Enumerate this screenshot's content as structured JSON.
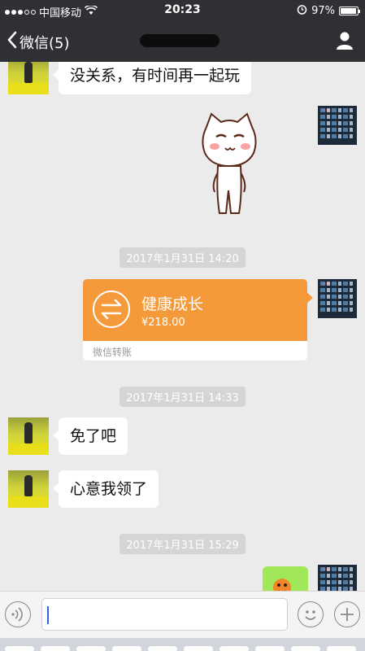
{
  "status_bar": {
    "carrier": "中国移动",
    "time": "20:23",
    "battery": "97%",
    "battery_level": 0.97,
    "icons": [
      "signal-dots-icon",
      "wifi-icon",
      "alarm-icon",
      "battery-icon"
    ]
  },
  "nav": {
    "back_label": "微信(5)",
    "icons": [
      "chevron-left-icon",
      "person-icon"
    ]
  },
  "messages": [
    {
      "side": "left",
      "type": "text",
      "text": "没关系，有时间再一起玩"
    },
    {
      "side": "right",
      "type": "sticker",
      "sticker": "white-cat-sticker"
    },
    {
      "type": "timestamp",
      "text": "2017年1月31日 14:20"
    },
    {
      "side": "right",
      "type": "transfer",
      "name": "健康成长",
      "amount": "¥218.00",
      "source": "微信转账",
      "icon": "transfer-arrows-icon"
    },
    {
      "type": "timestamp",
      "text": "2017年1月31日 14:33"
    },
    {
      "side": "left",
      "type": "text",
      "text": "免了吧"
    },
    {
      "side": "left",
      "type": "text",
      "text": "心意我领了"
    },
    {
      "type": "timestamp",
      "text": "2017年1月31日 15:29"
    },
    {
      "side": "right",
      "type": "sticker",
      "sticker": "orange-face-sticker"
    }
  ],
  "input_bar": {
    "value": "",
    "icons": [
      "voice-icon",
      "emoji-icon",
      "plus-icon"
    ]
  },
  "colors": {
    "nav_bg": "#2e3033",
    "chat_bg": "#ebebeb",
    "transfer_orange": "#f59a3b",
    "bubble_green": "#a0e75a"
  }
}
